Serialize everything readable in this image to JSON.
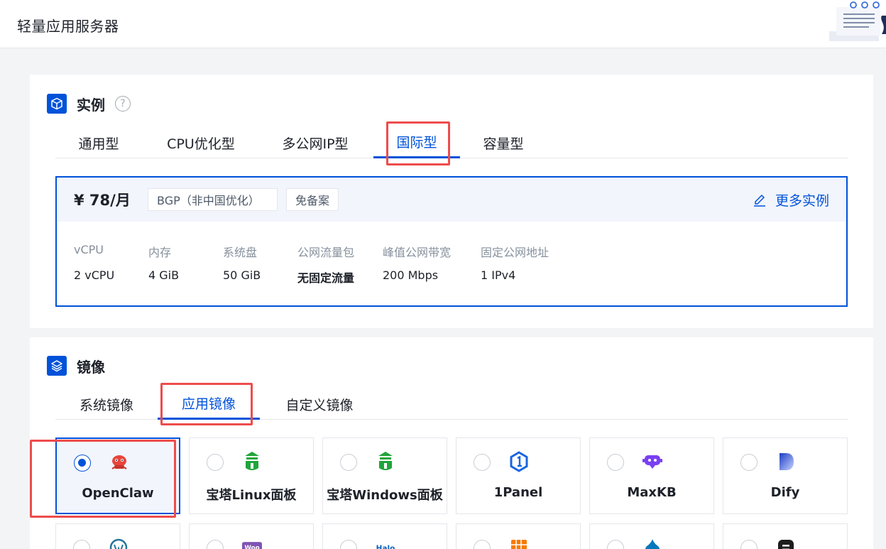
{
  "header": {
    "title": "轻量应用服务器"
  },
  "instance": {
    "section_title": "实例",
    "tabs": [
      {
        "label": "通用型"
      },
      {
        "label": "CPU优化型"
      },
      {
        "label": "多公网IP型"
      },
      {
        "label": "国际型",
        "active": true
      },
      {
        "label": "容量型"
      }
    ],
    "plan": {
      "price": "¥ 78/月",
      "tags": [
        "BGP（非中国优化）",
        "免备案"
      ],
      "more_link": "更多实例",
      "specs": [
        {
          "label": "vCPU",
          "value": "2 vCPU"
        },
        {
          "label": "内存",
          "value": "4 GiB"
        },
        {
          "label": "系统盘",
          "value": "50 GiB"
        },
        {
          "label": "公网流量包",
          "value": "无固定流量"
        },
        {
          "label": "峰值公网带宽",
          "value": "200 Mbps"
        },
        {
          "label": "固定公网地址",
          "value": "1 IPv4"
        }
      ]
    }
  },
  "image": {
    "section_title": "镜像",
    "tabs": [
      {
        "label": "系统镜像"
      },
      {
        "label": "应用镜像",
        "active": true
      },
      {
        "label": "自定义镜像"
      }
    ],
    "apps": [
      {
        "name": "OpenClaw",
        "icon": "openclaw-lobster-icon",
        "selected": true
      },
      {
        "name": "宝塔Linux面板",
        "icon": "baota-icon"
      },
      {
        "name": "宝塔Windows面板",
        "icon": "baota-icon"
      },
      {
        "name": "1Panel",
        "icon": "1panel-icon"
      },
      {
        "name": "MaxKB",
        "icon": "maxkb-icon"
      },
      {
        "name": "Dify",
        "icon": "dify-icon"
      }
    ],
    "apps_row2_icons": [
      "wordpress-icon",
      "woocommerce-icon",
      "halo-icon",
      "grid-app-icon",
      "drupal-icon",
      "app-icon"
    ]
  },
  "colors": {
    "accent": "#0052d9",
    "highlight": "#ee4c4c",
    "baota_green": "#20a53a",
    "openclaw_red": "#e8453c"
  }
}
